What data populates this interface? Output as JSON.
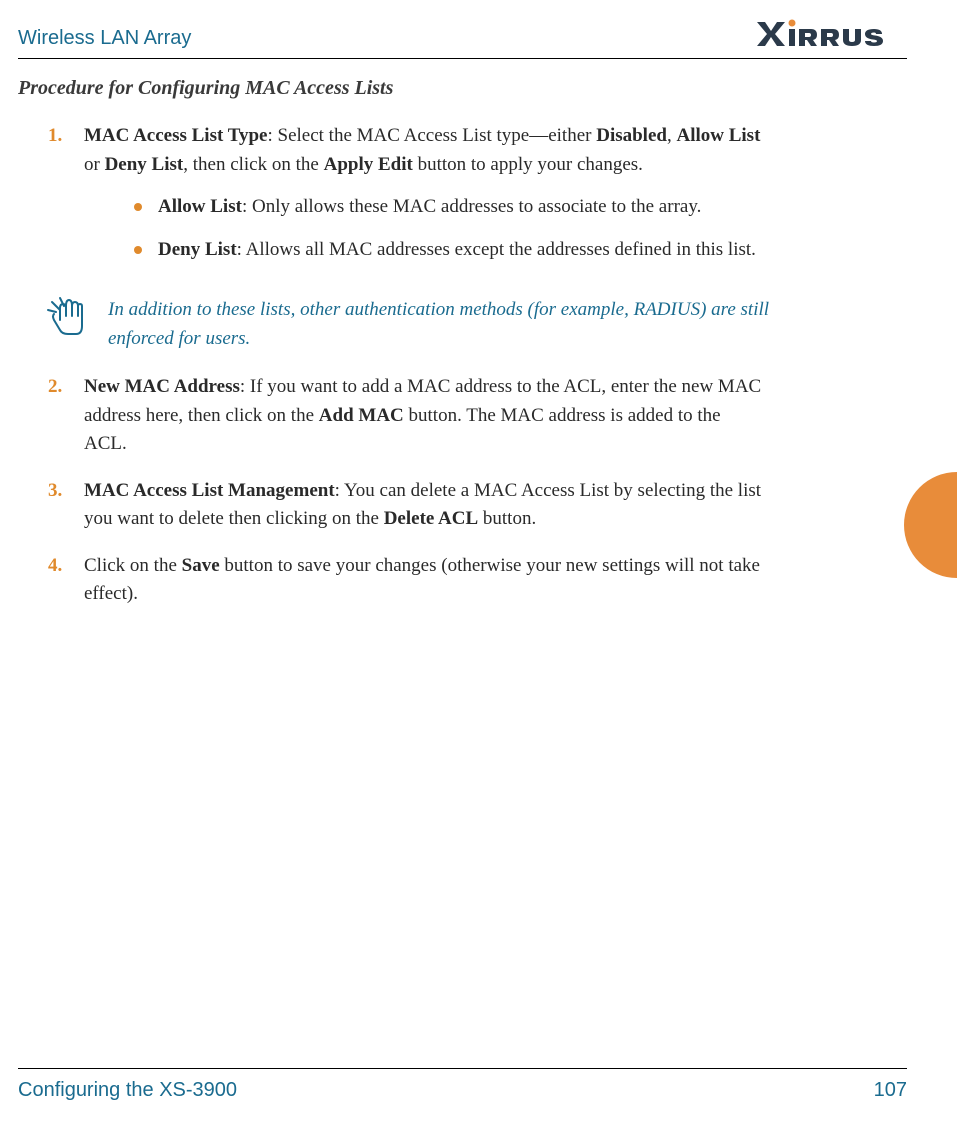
{
  "header": {
    "title": "Wireless LAN Array",
    "brand": "XIRRUS"
  },
  "section_title": "Procedure for Configuring MAC Access Lists",
  "items": [
    {
      "num": "1.",
      "lead": "MAC Access List Type",
      "text1": ": Select the MAC Access List type—either ",
      "bold2": "Disabled",
      "text2": ", ",
      "bold3": "Allow List",
      "text3": " or ",
      "bold4": "Deny List",
      "text4": ", then click on the ",
      "bold5": "Apply Edit",
      "text5": " button to apply your changes.",
      "subs": [
        {
          "lead": "Allow List",
          "text": ": Only allows these MAC addresses to associate to the array."
        },
        {
          "lead": "Deny List",
          "text": ": Allows all MAC addresses except the addresses defined in this list."
        }
      ]
    }
  ],
  "note": "In addition to these lists, other authentication methods (for example, RADIUS) are still enforced for users.",
  "items2": [
    {
      "num": "2.",
      "lead": "New MAC Address",
      "text1": ": If you want to add a MAC address to the ACL, enter the new MAC address here, then click on the ",
      "bold2": "Add MAC",
      "text2": " button. The MAC address is added to the ACL."
    },
    {
      "num": "3.",
      "lead": "MAC Access List Management",
      "text1": ": You can delete a MAC Access List by selecting the list you want to delete then clicking on the ",
      "bold2": "Delete ACL",
      "text2": " button."
    },
    {
      "num": "4.",
      "lead": "",
      "text1": "Click on the ",
      "bold2": "Save",
      "text2": " button to save your changes (otherwise your new settings will not take effect)."
    }
  ],
  "footer": {
    "left": "Configuring the XS-3900",
    "right": "107"
  }
}
